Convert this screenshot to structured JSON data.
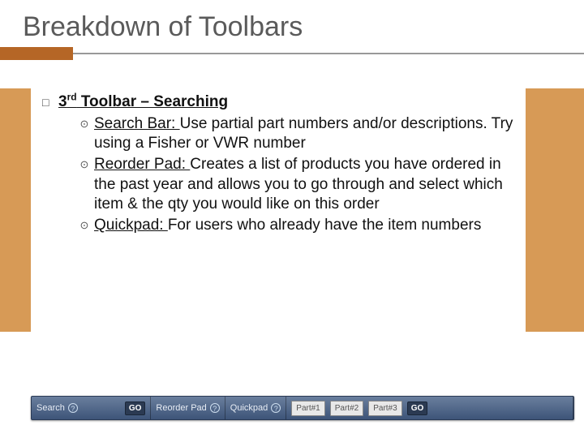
{
  "title": "Breakdown of Toolbars",
  "main": {
    "heading_prefix": "3",
    "heading_sup": "rd",
    "heading_rest": " Toolbar – Searching",
    "items": [
      {
        "label": "Search Bar: ",
        "text": "Use partial part numbers and/or descriptions. Try using a Fisher or VWR number"
      },
      {
        "label": "Reorder Pad: ",
        "text": "Creates a list of products you have ordered in the past year and allows you to go through and select which item & the qty you would like on this order"
      },
      {
        "label": "Quickpad:  ",
        "text": "For users who already have the item numbers"
      }
    ]
  },
  "toolbar": {
    "search_label": "Search",
    "go": "GO",
    "reorder_label": "Reorder Pad",
    "quickpad_label": "Quickpad",
    "part1": "Part#1",
    "part2": "Part#2",
    "part3": "Part#3",
    "help": "?"
  }
}
